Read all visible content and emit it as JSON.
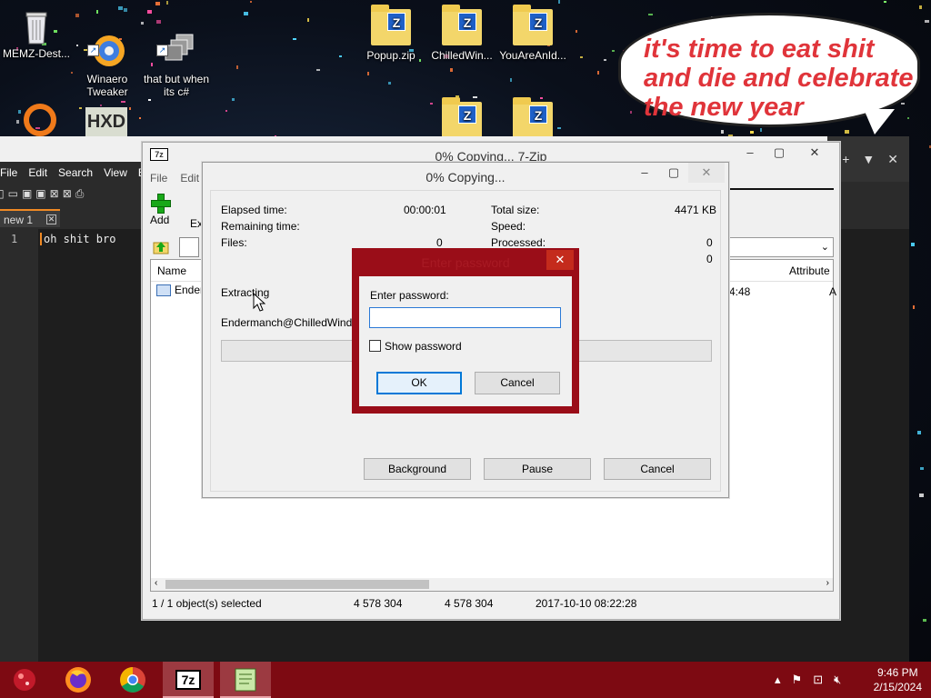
{
  "desktop": {
    "icons": [
      {
        "label": "MEMZ-Dest...",
        "kind": "recycle-bin"
      },
      {
        "label": "Winaero\nTweaker",
        "kind": "winaero"
      },
      {
        "label": "that but when\nits c#",
        "kind": "windows-stack"
      },
      {
        "label": "Popup.zip",
        "kind": "zip"
      },
      {
        "label": "ChilledWin...",
        "kind": "zip"
      },
      {
        "label": "YouAreAnId...",
        "kind": "zip"
      }
    ],
    "bubble_text": {
      "line1": "it's time to eat shit",
      "line2": "and die and celebrate",
      "line3": "the new year"
    }
  },
  "notepad": {
    "menu": [
      "File",
      "Edit",
      "Search",
      "View",
      "E"
    ],
    "tab_label": "new 1",
    "line_number": "1",
    "line_text": "oh shit bro"
  },
  "filemanager": {
    "title": "0% Copying... 7-Zip",
    "logo": "7z",
    "menu": [
      "File",
      "Edit"
    ],
    "add_label": "Add",
    "extract_label": "Ext",
    "columns": {
      "name": "Name",
      "attributes": "Attribute"
    },
    "row": {
      "name": "Enderr",
      "modified": "4:48",
      "attr": "A"
    },
    "status": {
      "selected": "1 / 1 object(s) selected",
      "size": "4 578 304",
      "packed": "4 578 304",
      "date": "2017-10-10 08:22:28"
    }
  },
  "progress": {
    "title": "0% Copying...",
    "elapsed_label": "Elapsed time:",
    "elapsed_value": "00:00:01",
    "remaining_label": "Remaining time:",
    "files_label": "Files:",
    "files_value": "0",
    "total_label": "Total size:",
    "total_value": "4471 KB",
    "speed_label": "Speed:",
    "processed_label": "Processed:",
    "processed_value": "0",
    "extra_value": "0",
    "operation": "Extracting",
    "current_file": "Endermanch@ChilledWindows",
    "progress_fraction": 0,
    "buttons": {
      "background": "Background",
      "pause": "Pause",
      "cancel": "Cancel"
    }
  },
  "password": {
    "title": "Enter password",
    "prompt": "Enter password:",
    "value": "",
    "show_label": "Show password",
    "show_checked": false,
    "ok": "OK",
    "cancel": "Cancel"
  },
  "taskbar": {
    "time": "9:46 PM",
    "date": "2/15/2024"
  },
  "colors": {
    "taskbar": "#7d0a12",
    "dialog_border": "#9a0d18",
    "bubble_text": "#e0343a"
  }
}
